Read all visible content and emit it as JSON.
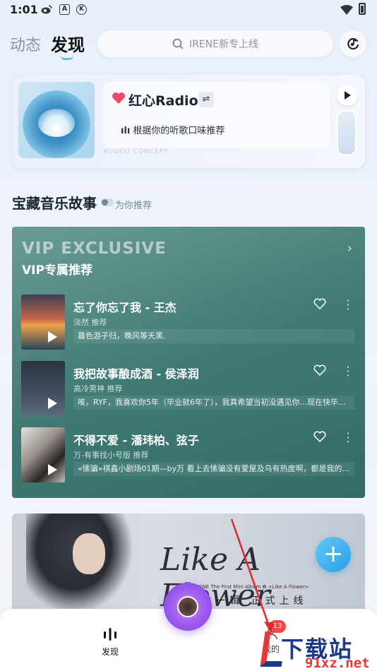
{
  "status_bar": {
    "time": "1:01",
    "a_icon": "A",
    "k_icon": "K"
  },
  "header": {
    "tab_dongtai": "动态",
    "tab_faxian": "发现",
    "search_placeholder": "IRENE新专上线"
  },
  "radio": {
    "title": "红心Radio",
    "swap_symbol": "⇌",
    "subtitle": "根据你的听歌口味推荐",
    "concept": "KUGOU CONCEPT"
  },
  "section": {
    "title": "宝藏音乐故事",
    "subtitle": "为你推荐"
  },
  "vip": {
    "title": "VIP EXCLUSIVE",
    "subtitle": "VIP专属推荐",
    "songs": [
      {
        "title": "忘了你忘了我 - 王杰",
        "tag": "淡然 推荐",
        "desc": "暮色游子归，晚风等天黑."
      },
      {
        "title": "我把故事酿成酒 - 侯泽润",
        "tag": "高冷男神 推荐",
        "desc": "唉，RYF，我喜欢你5年（毕业就6年了），我真希望当初没遇见你...现在快毕..."
      },
      {
        "title": "不得不爱 - 潘玮柏、弦子",
        "tag": "万-有事找小号版 推荐",
        "desc": "«愫骗»祺鑫小剧场01期—by万  看上去愫骗没有爱屋及乌有热度啊，都是我的..."
      }
    ]
  },
  "banner": {
    "script_text": "Like A Flower",
    "line_text": "IRENE  The First Mini Album  ✿  <Like A Flower>",
    "cn_text": "你一辑    正式上线"
  },
  "fab": {
    "symbol": "+"
  },
  "bottom_nav": {
    "faxian": "发现",
    "mine": "我的",
    "badge": "13"
  },
  "watermark": {
    "logo": "下载站",
    "url": "91xz.net"
  },
  "colors": {
    "accent": "#2aa0e8",
    "vip_bg": "#3f7a73",
    "badge": "#f24848",
    "center_disc": "#9c58ee"
  }
}
